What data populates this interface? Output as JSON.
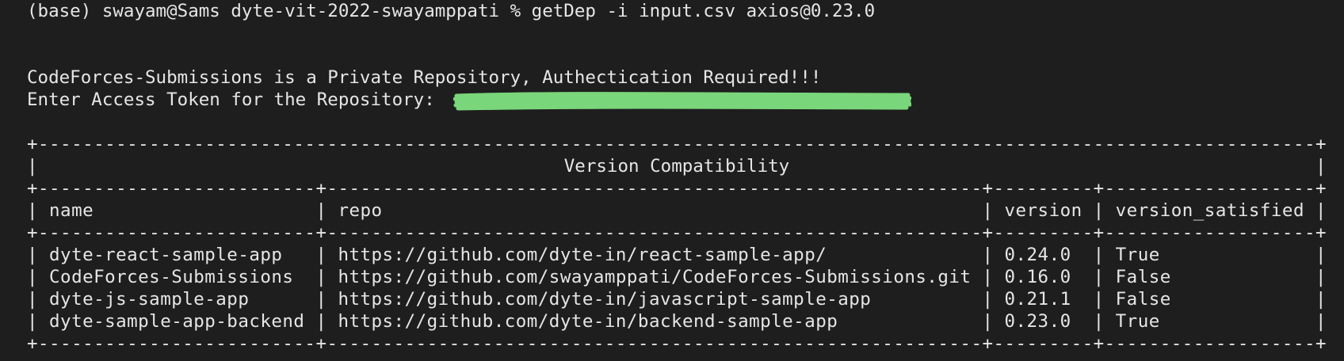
{
  "terminal": {
    "prompt_line": "(base) swayam@Sams dyte-vit-2022-swayamppati % getDep -i input.csv axios@0.23.0",
    "private_msg": "CodeForces-Submissions is a Private Repository, Authectication Required!!!",
    "token_prompt": "Enter Access Token for the Repository: ",
    "redaction_color": "#7ad67a"
  },
  "table": {
    "title": "Version Compatibility",
    "headers": [
      "name",
      "repo",
      "version",
      "version_satisfied"
    ],
    "rows": [
      [
        "dyte-react-sample-app",
        "https://github.com/dyte-in/react-sample-app/",
        "0.24.0",
        "True"
      ],
      [
        "CodeForces-Submissions",
        "https://github.com/swayamppati/CodeForces-Submissions.git",
        "0.16.0",
        "False"
      ],
      [
        "dyte-js-sample-app",
        "https://github.com/dyte-in/javascript-sample-app",
        "0.21.1",
        "False"
      ],
      [
        "dyte-sample-app-backend",
        "https://github.com/dyte-in/backend-sample-app",
        "0.23.0",
        "True"
      ]
    ]
  }
}
